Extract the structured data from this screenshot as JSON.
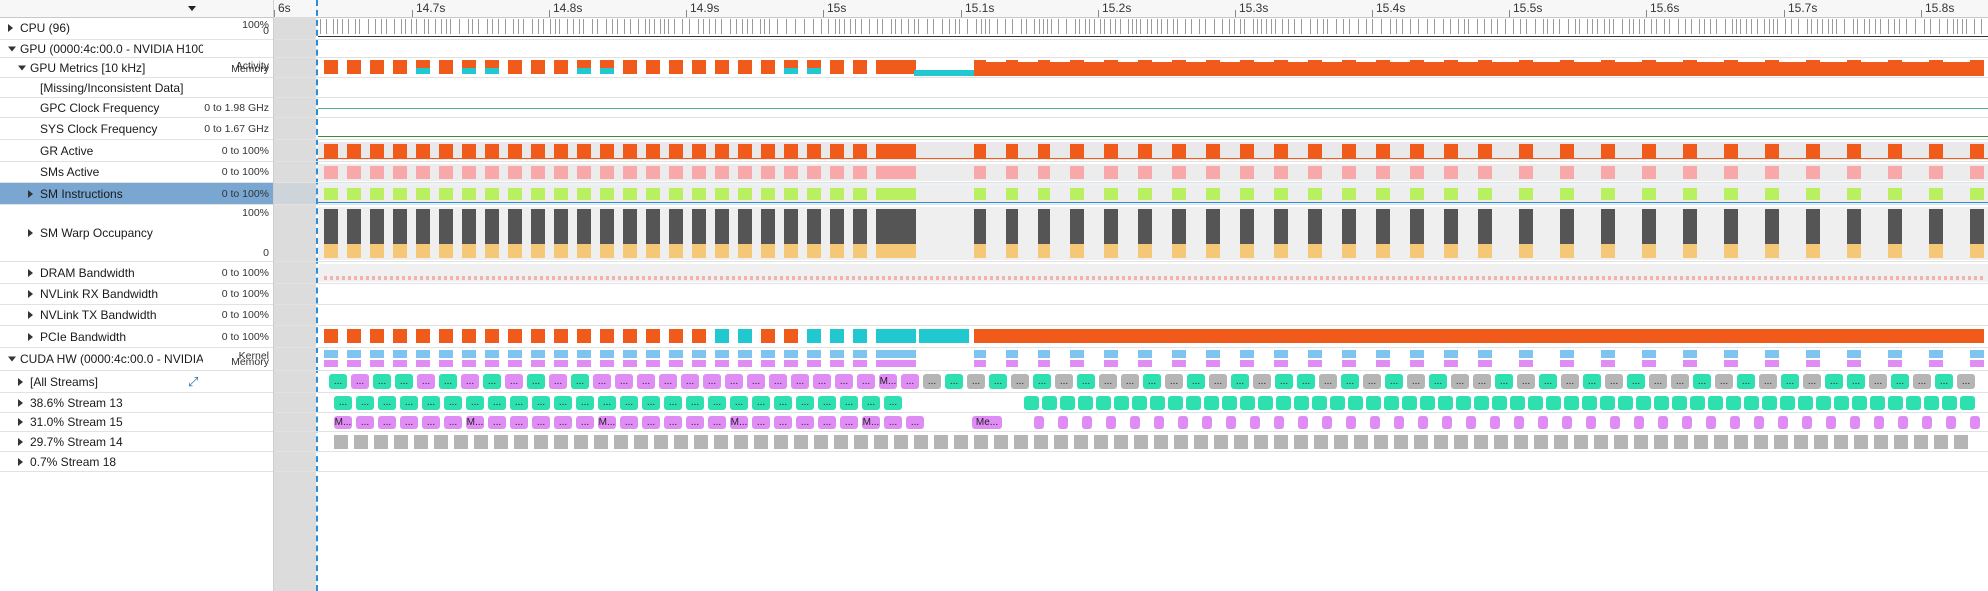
{
  "ruler": {
    "ticks": [
      "6s",
      "14.7s",
      "14.8s",
      "14.9s",
      "15s",
      "15.1s",
      "15.2s",
      "15.3s",
      "15.4s",
      "15.5s",
      "15.6s",
      "15.7s",
      "15.8s"
    ]
  },
  "rows": [
    {
      "id": "cpu",
      "label": "CPU (96)",
      "indent": 0,
      "arrow": "right",
      "scale": {
        "top": "100%",
        "bottom": "0"
      }
    },
    {
      "id": "gpu",
      "label": "GPU (0000:4c:00.0 - NVIDIA H100",
      "indent": 0,
      "arrow": "down",
      "scale": {}
    },
    {
      "id": "gpu-metrics",
      "label": "GPU Metrics [10 kHz]",
      "indent": 1,
      "arrow": "down",
      "scale": {
        "top": "Activity",
        "bottom": "Memory"
      }
    },
    {
      "id": "missing",
      "label": "[Missing/Inconsistent Data]",
      "indent": 2,
      "arrow": "none",
      "scale": {}
    },
    {
      "id": "gpc-clock",
      "label": "GPC Clock Frequency",
      "indent": 2,
      "arrow": "none",
      "scale": {
        "center": "0 to 1.98 GHz"
      }
    },
    {
      "id": "sys-clock",
      "label": "SYS Clock Frequency",
      "indent": 2,
      "arrow": "none",
      "scale": {
        "center": "0 to 1.67 GHz"
      }
    },
    {
      "id": "gr-active",
      "label": "GR Active",
      "indent": 2,
      "arrow": "none",
      "scale": {
        "center": "0 to 100%"
      }
    },
    {
      "id": "sms-active",
      "label": "SMs Active",
      "indent": 2,
      "arrow": "none",
      "scale": {
        "center": "0 to 100%"
      }
    },
    {
      "id": "sm-instr",
      "label": "SM Instructions",
      "indent": 2,
      "arrow": "right",
      "selected": true,
      "scale": {
        "center": "0 to 100%"
      }
    },
    {
      "id": "sm-warp",
      "label": "SM Warp Occupancy",
      "indent": 2,
      "arrow": "right",
      "scale": {
        "top": "100%",
        "bottom": "0"
      }
    },
    {
      "id": "dram",
      "label": "DRAM Bandwidth",
      "indent": 2,
      "arrow": "right",
      "scale": {
        "center": "0 to 100%"
      }
    },
    {
      "id": "nvlink-rx",
      "label": "NVLink RX Bandwidth",
      "indent": 2,
      "arrow": "right",
      "scale": {
        "center": "0 to 100%"
      }
    },
    {
      "id": "nvlink-tx",
      "label": "NVLink TX Bandwidth",
      "indent": 2,
      "arrow": "right",
      "scale": {
        "center": "0 to 100%"
      }
    },
    {
      "id": "pcie",
      "label": "PCIe Bandwidth",
      "indent": 2,
      "arrow": "right",
      "scale": {
        "center": "0 to 100%"
      }
    },
    {
      "id": "cuda-hw",
      "label": "CUDA HW (0000:4c:00.0 - NVIDIA I",
      "indent": 0,
      "arrow": "down",
      "scale": {
        "top": "Kernel",
        "bottom": "Memory"
      }
    },
    {
      "id": "all-streams",
      "label": "[All Streams]",
      "indent": 1,
      "arrow": "right",
      "expand_icon": true,
      "scale": {}
    },
    {
      "id": "stream-13",
      "label": "38.6% Stream 13",
      "indent": 1,
      "arrow": "right",
      "scale": {}
    },
    {
      "id": "stream-15",
      "label": "31.0% Stream 15",
      "indent": 1,
      "arrow": "right",
      "scale": {}
    },
    {
      "id": "stream-14",
      "label": "29.7% Stream 14",
      "indent": 1,
      "arrow": "right",
      "scale": {}
    },
    {
      "id": "stream-18",
      "label": "0.7% Stream 18",
      "indent": 1,
      "arrow": "right",
      "scale": {}
    }
  ],
  "kernel_labels": {
    "ellipsis": "...",
    "m": "M...",
    "me": "Me..."
  },
  "colors": {
    "orange": "#f05a1a",
    "cyan": "#22c8d0",
    "pink": "#f8a8a8",
    "lime": "#b8f060",
    "darkgray": "#555555",
    "tan": "#f5c878",
    "lightblue": "#7ec4f0",
    "teal_kernel": "#2ee0b0",
    "purple_kernel": "#e08cf5",
    "gray_kernel": "#b5b5b5",
    "selected": "#7aa7d2"
  }
}
